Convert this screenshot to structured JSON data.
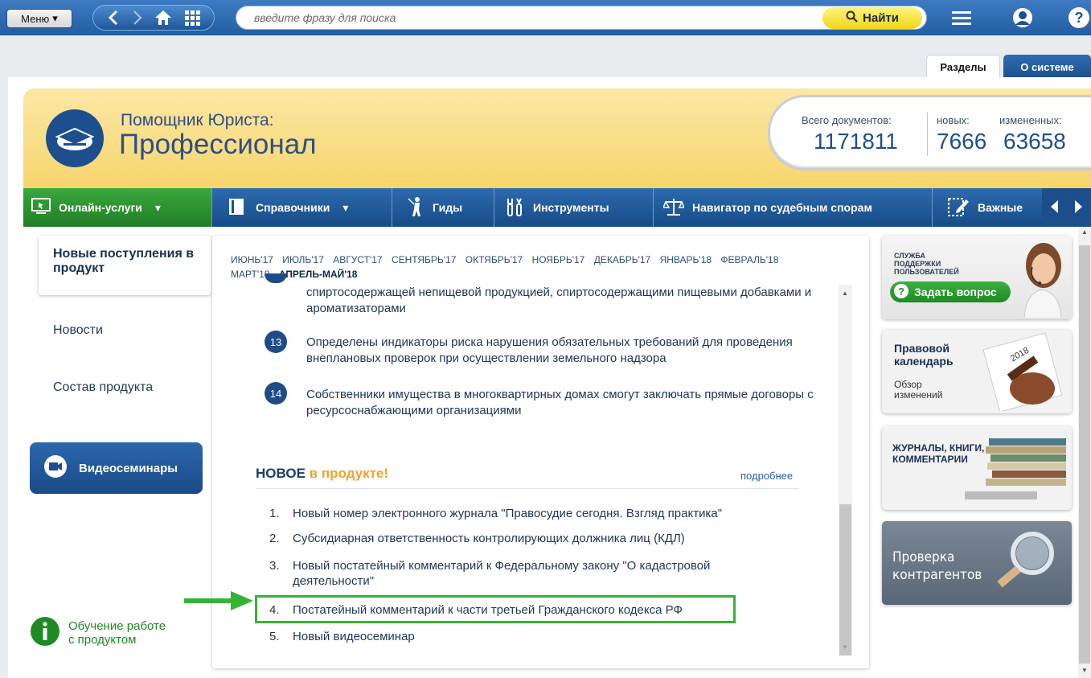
{
  "topbar": {
    "menu_label": "Меню",
    "search_placeholder": "введите фразу для поиска",
    "find_label": "Найти"
  },
  "tabs": {
    "sections": "Разделы",
    "about": "О системе"
  },
  "header": {
    "brand_line1": "Помощник Юриста:",
    "brand_line2": "Профессионал",
    "stats": {
      "total_label": "Всего документов:",
      "total_value": "1171811",
      "new_label": "новых:",
      "new_value": "7666",
      "changed_label": "измененных:",
      "changed_value": "63658"
    }
  },
  "navbar": {
    "items": [
      {
        "label": "Онлайн-услуги"
      },
      {
        "label": "Справочники"
      },
      {
        "label": "Гиды"
      },
      {
        "label": "Инструменты"
      },
      {
        "label": "Навигатор по судебным спорам"
      },
      {
        "label": "Важные"
      }
    ]
  },
  "left": {
    "active_card": "Новые поступления в продукт",
    "news": "Новости",
    "composition": "Состав продукта",
    "video": "Видеосеминары",
    "learn_line1": "Обучение работе",
    "learn_line2": "с продуктом"
  },
  "months": {
    "items": [
      "ИЮНЬ'17",
      "ИЮЛЬ'17",
      "АВГУСТ'17",
      "СЕНТЯБРЬ'17",
      "ОКТЯБРЬ'17",
      "НОЯБРЬ'17",
      "ДЕКАБРЬ'17",
      "ЯНВАРЬ'18",
      "ФЕВРАЛЬ'18",
      "МАРТ'18"
    ],
    "active": "АПРЕЛЬ-МАЙ'18"
  },
  "news_items": [
    {
      "num": "",
      "text": "спиртосодержащей непищевой продукцией, спиртосодержащими пищевыми добавками и ароматизаторами"
    },
    {
      "num": "13",
      "text": "Определены индикаторы риска нарушения обязательных требований для проведения внеплановых проверок при осуществлении земельного надзора"
    },
    {
      "num": "14",
      "text": "Собственники имущества в многоквартирных домах смогут заключать прямые договоры с ресурсоснабжающими организациями"
    }
  ],
  "new_in_product": {
    "title_part1": "НОВОЕ",
    "title_part2": "в продукте!",
    "more": "подробнее",
    "items": [
      {
        "n": "1.",
        "text": "Новый номер электронного журнала \"Правосудие сегодня. Взгляд практика\""
      },
      {
        "n": "2.",
        "text": "Субсидиарная ответственность контролирующих должника лиц (КДЛ)"
      },
      {
        "n": "3.",
        "text": "Новый постатейный комментарий к Федеральному закону \"О кадастровой деятельности\""
      },
      {
        "n": "4.",
        "text": "Постатейный комментарий к части третьей Гражданского кодекса РФ"
      },
      {
        "n": "5.",
        "text": "Новый видеосеминар"
      }
    ]
  },
  "right": {
    "support_line1": "СЛУЖБА",
    "support_line2": "ПОДДЕРЖКИ",
    "support_line3": "ПОЛЬЗОВАТЕЛЕЙ",
    "ask_label": "Задать вопрос",
    "calendar_line1": "Правовой",
    "calendar_line2": "календарь",
    "calendar_sub1": "Обзор",
    "calendar_sub2": "изменений",
    "calendar_year": "2018",
    "books_line1": "ЖУРНАЛЫ, КНИГИ,",
    "books_line2": "КОММЕНТАРИИ",
    "check_line1": "Проверка",
    "check_line2": "контрагентов"
  },
  "colors": {
    "brand_blue": "#1d4e8d",
    "accent_green": "#36b336",
    "accent_orange": "#f0a229",
    "find_yellow": "#f1d51a"
  }
}
